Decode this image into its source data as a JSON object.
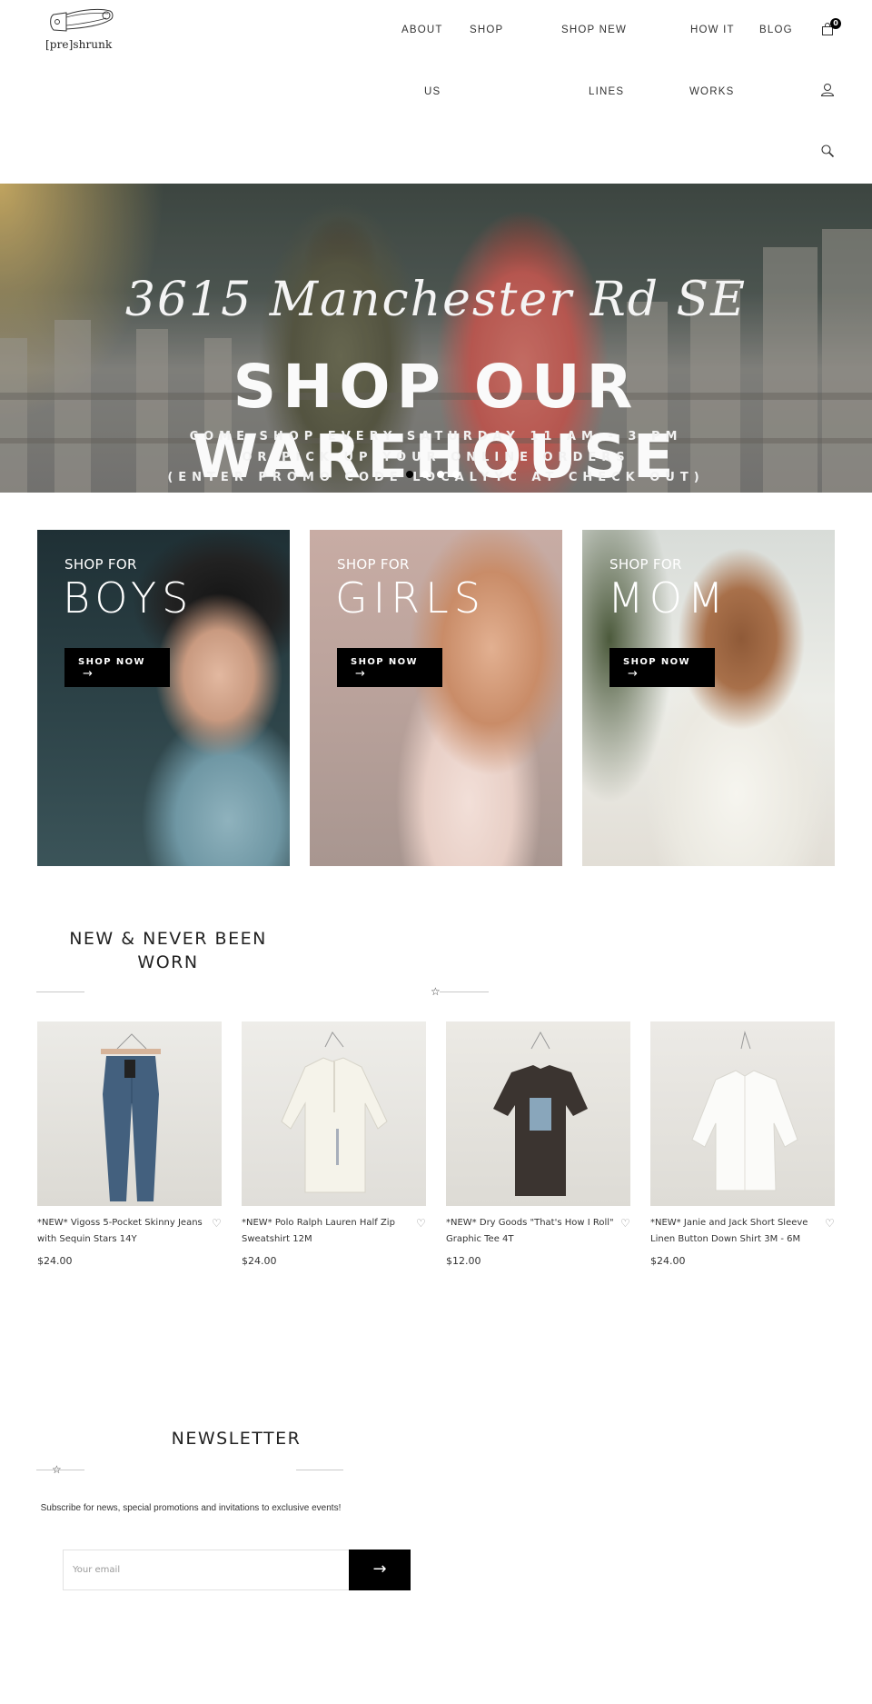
{
  "header": {
    "logo_text": "[pre]shrunk",
    "nav": [
      {
        "line1": "ABOUT",
        "line2": "US"
      },
      {
        "line1": "SHOP",
        "line2": ""
      },
      {
        "line1": "SHOP NEW",
        "line2": "LINES"
      },
      {
        "line1": "HOW IT",
        "line2": "WORKS"
      },
      {
        "line1": "BLOG",
        "line2": ""
      }
    ],
    "icons": [
      "cart-icon",
      "user-icon",
      "search-icon"
    ],
    "cart_count": "0"
  },
  "hero": {
    "address": "3615 Manchester Rd SE",
    "title": "SHOP OUR WAREHOUSE",
    "lines": [
      "COME SHOP EVERY SATURDAY 11 AM - 3 PM",
      "OR PICK UP YOUR ONLINE ORDERS",
      "(ENTER PROMO CODE LOCALYYC AT CHECK OUT)"
    ],
    "slides": 4,
    "active_slide": 1
  },
  "categories": [
    {
      "kicker": "SHOP FOR",
      "title": "BOYS",
      "button": "SHOP NOW"
    },
    {
      "kicker": "SHOP FOR",
      "title": "GIRLS",
      "button": "SHOP NOW"
    },
    {
      "kicker": "SHOP FOR",
      "title": "MOM",
      "button": "SHOP NOW"
    }
  ],
  "new_section": {
    "title_line1": "NEW & NEVER BEEN",
    "title_line2": "WORN",
    "products": [
      {
        "name": "*NEW* Vigoss 5-Pocket Skinny Jeans with Sequin Stars 14Y",
        "price": "$24.00"
      },
      {
        "name": "*NEW* Polo Ralph Lauren Half Zip Sweatshirt 12M",
        "price": "$24.00"
      },
      {
        "name": "*NEW* Dry Goods \"That's How I Roll\" Graphic Tee 4T",
        "price": "$12.00"
      },
      {
        "name": "*NEW* Janie and Jack Short Sleeve Linen Button Down Shirt 3M - 6M",
        "price": "$24.00"
      }
    ]
  },
  "newsletter": {
    "title": "NEWSLETTER",
    "description": "Subscribe for news, special promotions and invitations to exclusive events!",
    "email_placeholder": "Your email",
    "email_value": "",
    "submit_icon": "arrow-right-icon"
  },
  "colors": {
    "accent": "#000000",
    "text": "#222222",
    "rule": "#c9c9c9"
  }
}
